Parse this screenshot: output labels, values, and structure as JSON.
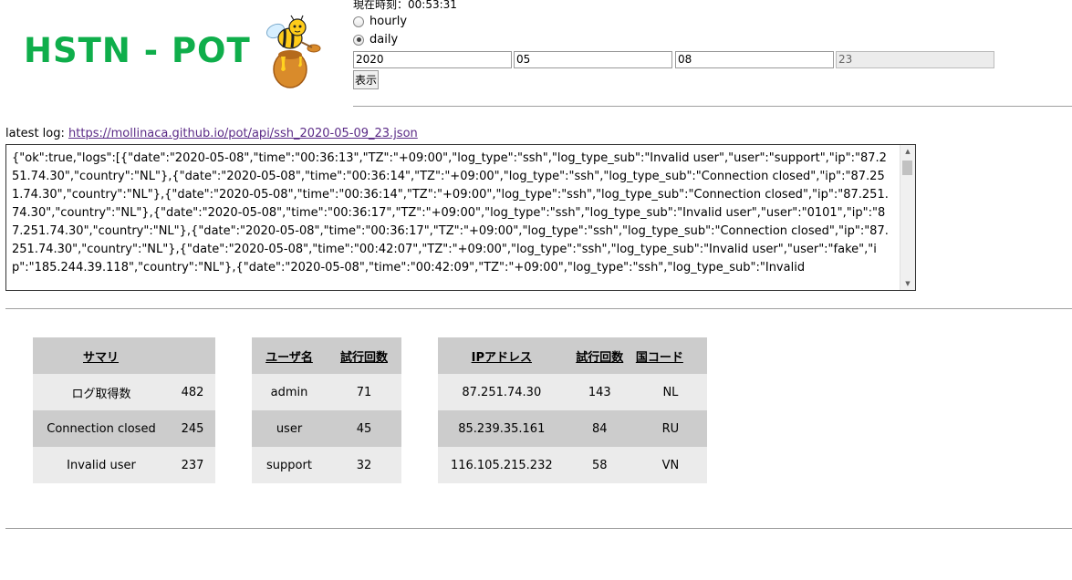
{
  "header": {
    "logo_text": "HSTN - POT",
    "clock": "現在時刻：00:53:31"
  },
  "controls": {
    "radio_hourly": "hourly",
    "radio_daily": "daily",
    "selected": "daily",
    "year": "2020",
    "month": "05",
    "day": "08",
    "hour": "23",
    "show_button": "表示"
  },
  "latest": {
    "label": "latest log: ",
    "url": "https://mollinaca.github.io/pot/api/ssh_2020-05-09_23.json"
  },
  "log_text": "{\"ok\":true,\"logs\":[{\"date\":\"2020-05-08\",\"time\":\"00:36:13\",\"TZ\":\"+09:00\",\"log_type\":\"ssh\",\"log_type_sub\":\"Invalid user\",\"user\":\"support\",\"ip\":\"87.251.74.30\",\"country\":\"NL\"},{\"date\":\"2020-05-08\",\"time\":\"00:36:14\",\"TZ\":\"+09:00\",\"log_type\":\"ssh\",\"log_type_sub\":\"Connection closed\",\"ip\":\"87.251.74.30\",\"country\":\"NL\"},{\"date\":\"2020-05-08\",\"time\":\"00:36:14\",\"TZ\":\"+09:00\",\"log_type\":\"ssh\",\"log_type_sub\":\"Connection closed\",\"ip\":\"87.251.74.30\",\"country\":\"NL\"},{\"date\":\"2020-05-08\",\"time\":\"00:36:17\",\"TZ\":\"+09:00\",\"log_type\":\"ssh\",\"log_type_sub\":\"Invalid user\",\"user\":\"0101\",\"ip\":\"87.251.74.30\",\"country\":\"NL\"},{\"date\":\"2020-05-08\",\"time\":\"00:36:17\",\"TZ\":\"+09:00\",\"log_type\":\"ssh\",\"log_type_sub\":\"Connection closed\",\"ip\":\"87.251.74.30\",\"country\":\"NL\"},{\"date\":\"2020-05-08\",\"time\":\"00:42:07\",\"TZ\":\"+09:00\",\"log_type\":\"ssh\",\"log_type_sub\":\"Invalid user\",\"user\":\"fake\",\"ip\":\"185.244.39.118\",\"country\":\"NL\"},{\"date\":\"2020-05-08\",\"time\":\"00:42:09\",\"TZ\":\"+09:00\",\"log_type\":\"ssh\",\"log_type_sub\":\"Invalid",
  "summary": {
    "header": "サマリ",
    "rows": [
      {
        "label": "ログ取得数",
        "value": "482"
      },
      {
        "label": "Connection closed",
        "value": "245"
      },
      {
        "label": "Invalid user",
        "value": "237"
      }
    ]
  },
  "users": {
    "headers": [
      "ユーザ名",
      "試行回数"
    ],
    "rows": [
      {
        "name": "admin",
        "count": "71"
      },
      {
        "name": "user",
        "count": "45"
      },
      {
        "name": "support",
        "count": "32"
      }
    ]
  },
  "ips": {
    "headers": [
      "IPアドレス",
      "試行回数",
      "国コード"
    ],
    "rows": [
      {
        "ip": "87.251.74.30",
        "count": "143",
        "country": "NL"
      },
      {
        "ip": "85.239.35.161",
        "count": "84",
        "country": "RU"
      },
      {
        "ip": "116.105.215.232",
        "count": "58",
        "country": "VN"
      }
    ]
  }
}
